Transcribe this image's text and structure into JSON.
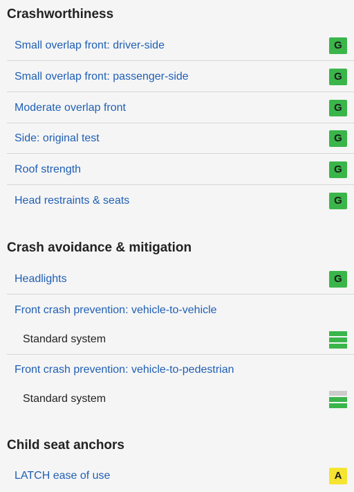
{
  "colors": {
    "link": "#1f5fb4",
    "good": "#3ab54a",
    "acceptable": "#f5e531",
    "bar_off": "#cccccc",
    "divider": "#d6d6d6"
  },
  "crashworthiness": {
    "title": "Crashworthiness",
    "items": [
      {
        "label": "Small overlap front: driver-side",
        "rating": "G"
      },
      {
        "label": "Small overlap front: passenger-side",
        "rating": "G"
      },
      {
        "label": "Moderate overlap front",
        "rating": "G"
      },
      {
        "label": "Side: original test",
        "rating": "G"
      },
      {
        "label": "Roof strength",
        "rating": "G"
      },
      {
        "label": "Head restraints & seats",
        "rating": "G"
      }
    ]
  },
  "crash_avoidance": {
    "title": "Crash avoidance & mitigation",
    "headlights": {
      "label": "Headlights",
      "rating": "G"
    },
    "vehicle_to_vehicle": {
      "label": "Front crash prevention: vehicle-to-vehicle",
      "system": "Standard system",
      "rating_bars": {
        "filled": 3,
        "total": 3
      }
    },
    "vehicle_to_pedestrian": {
      "label": "Front crash prevention: vehicle-to-pedestrian",
      "system": "Standard system",
      "rating_bars": {
        "filled": 2,
        "total": 3
      }
    }
  },
  "child_seat": {
    "title": "Child seat anchors",
    "latch": {
      "label": "LATCH ease of use",
      "rating": "A"
    }
  }
}
